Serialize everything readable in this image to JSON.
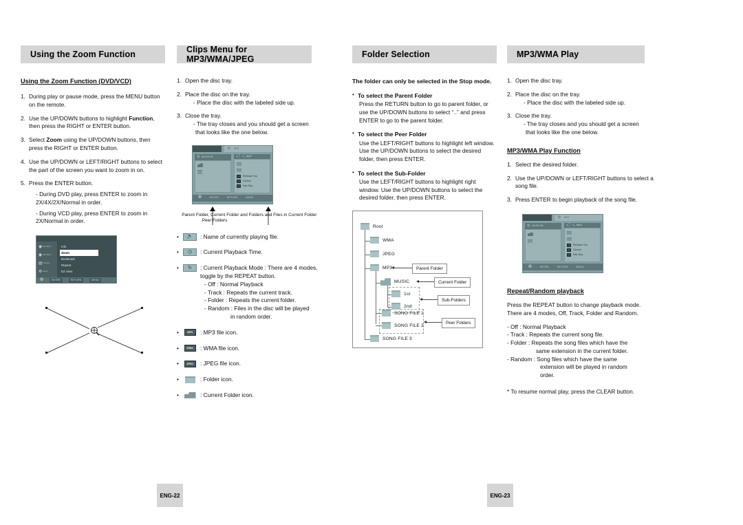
{
  "sections": [
    {
      "title": "Using the Zoom Function"
    },
    {
      "title": "Clips Menu for MP3/WMA/JPEG"
    },
    {
      "title": "Folder Selection"
    },
    {
      "title": "MP3/WMA Play"
    }
  ],
  "col1": {
    "subheading": "Using the Zoom Function (DVD/VCD)",
    "steps": [
      {
        "num": "1.",
        "text": "During play or pause mode, press the MENU button on the remote."
      },
      {
        "num": "2.",
        "text_a": "Use the UP/DOWN buttons to highlight ",
        "bold": "Function",
        "text_b": ", then press the RIGHT or ENTER button."
      },
      {
        "num": "3.",
        "text_a": "Select ",
        "bold": "Zoom",
        "text_b": " using the UP/DOWN buttons, then press the RIGHT or ENTER button."
      },
      {
        "num": "4.",
        "text": "Use the UP/DOWN or LEFT/RIGHT buttons to select the part of the screen you want to zoom in on."
      },
      {
        "num": "5.",
        "text": "Press the ENTER button.",
        "sub": [
          "- During DVD play, press ENTER to zoom in 2X/4X/2X/Normal in order.",
          "- During VCD play, press ENTER to zoom in 2X/Normal in order."
        ],
        "sub_indent": [
          "2X/4X/2X/Normal in order.",
          "in order."
        ]
      }
    ],
    "osd": {
      "side_items": [
        {
          "icon": "disc-menu-icon",
          "label": "Disc Menu"
        },
        {
          "icon": "title-menu-icon",
          "label": "Title Menu"
        },
        {
          "icon": "function-icon",
          "label": "Function"
        },
        {
          "icon": "setup-icon",
          "label": "Setup"
        }
      ],
      "menu_items": [
        "Info",
        "Zoom",
        "Bookmark",
        "Repeat",
        "EZ View"
      ],
      "selected_item": "Zoom",
      "buttons": [
        "ENTER",
        "RETURN",
        "MENU"
      ]
    },
    "zoom_graphic": {
      "icon": "magnifier-icon"
    }
  },
  "col2": {
    "steps": [
      {
        "num": "1.",
        "text": "Open the disc tray."
      },
      {
        "num": "2.",
        "text": "Place the disc on the tray.",
        "sub": [
          "- Place the disc with the labeled side up."
        ]
      },
      {
        "num": "3.",
        "text": "Close the tray.",
        "sub": [
          "- The tray closes and you should get a screen"
        ],
        "sub_cont": "that looks like the one below."
      }
    ],
    "clips_screen": {
      "mode_label": "Off",
      "mode_icon": "repeat-icon",
      "left_pane": {
        "icon": "clock-icon",
        "value": "00:00:23"
      },
      "right_pane": {
        "icon": "speaker-icon",
        "value": "1_.mp3"
      },
      "files": [
        "Release You",
        "Cactus",
        "Sad Day"
      ],
      "buttons": [
        "ENTER",
        "RETURN",
        "MENU"
      ]
    },
    "callouts": [
      "Parent Folder, Current Folder and Peer Folders",
      "Folders and Files in Current Folder"
    ],
    "legend": [
      {
        "icon": "playing-file-icon",
        "glyph": "speaker",
        "text": ": Name of currently playing file."
      },
      {
        "icon": "playback-time-icon",
        "glyph": "clock",
        "text": ": Current Playback Time."
      },
      {
        "icon": "playback-mode-icon",
        "glyph": "repeat",
        "text": ": Current Playback Mode : There are 4 modes, toggle by the REPEAT button.",
        "sub": [
          "- Off : Normal Playback",
          "- Track : Repeats the current track.",
          "- Folder : Repeats the current folder.",
          "- Random : Files in the disc will be played"
        ],
        "sub_cont": "in random order."
      },
      {
        "icon": "mp3-file-icon",
        "tag": "MP3",
        "text": ": MP3 file icon."
      },
      {
        "icon": "wma-file-icon",
        "tag": "WMA",
        "text": ": WMA file icon."
      },
      {
        "icon": "jpeg-file-icon",
        "tag": "JPEG",
        "text": ": JPEG file icon."
      },
      {
        "icon": "folder-icon",
        "shape": "folder",
        "text": ": Folder icon."
      },
      {
        "icon": "current-folder-icon",
        "shape": "current-folder",
        "text": ": Current Folder icon."
      }
    ]
  },
  "col3": {
    "intro": "The folder can only be selected in the Stop mode.",
    "blocks": [
      {
        "head": "To select the Parent Folder",
        "body": "Press the RETURN button to go to parent folder, or use the UP/DOWN buttons to select “..” and press ENTER to go to the parent folder."
      },
      {
        "head": "To select the Peer Folder",
        "body": "Use the LEFT/RIGHT buttons to highlight left window. Use the UP/DOWN buttons to select the desired folder, then press ENTER."
      },
      {
        "head": "To select the Sub-Folder",
        "body": "Use the LEFT/RIGHT buttons to highlight right window. Use the UP/DOWN buttons to select the desired folder, then press ENTER."
      }
    ],
    "tree": {
      "nodes": [
        {
          "label": "Root"
        },
        {
          "label": "WMA"
        },
        {
          "label": "JPEG"
        },
        {
          "label": "MP3"
        },
        {
          "label": "MUSIC"
        },
        {
          "label": "1st"
        },
        {
          "label": "2nd"
        },
        {
          "label": "SONG FILE 1"
        },
        {
          "label": "SONG FILE 2"
        },
        {
          "label": "SONG FILE 3"
        }
      ],
      "callouts": [
        "Parent Folder",
        "Current Folder",
        "Sub-Folders",
        "Peer Folders"
      ]
    }
  },
  "col4": {
    "steps": [
      {
        "num": "1.",
        "text": "Open the disc tray."
      },
      {
        "num": "2.",
        "text": "Place the disc on the tray.",
        "sub": [
          "- Place the disc with the labeled side up."
        ]
      },
      {
        "num": "3.",
        "text": "Close the tray.",
        "sub": [
          "- The tray closes and you should get a screen"
        ],
        "sub_cont": "that looks like the one below."
      }
    ],
    "subheading": "MP3/WMA Play Function",
    "play_steps": [
      {
        "num": "1.",
        "text": "Select the desired folder."
      },
      {
        "num": "2.",
        "text": "Use the UP/DOWN or LEFT/RIGHT buttons to select a song file."
      },
      {
        "num": "3.",
        "text": "Press ENTER to begin playback of the song file."
      }
    ],
    "play_screen": {
      "mode_label": "Off",
      "left_pane": {
        "icon": "clock-icon",
        "value": "00:00:23"
      },
      "right_pane": {
        "icon": "speaker-icon",
        "value": "1_.mp3"
      },
      "files": [
        "Release You",
        "Cactus",
        "Sad Day"
      ],
      "buttons": [
        "ENTER",
        "RETURN",
        "MENU"
      ]
    },
    "repeat_heading": "Repeat/Random playback",
    "repeat_body": "Press the REPEAT button to change playback mode. There are 4 modes, Off, Track, Folder and Random.",
    "repeat_modes": [
      "- Off : Normal Playback",
      "- Track : Repeats the current song file.",
      "- Folder : Repeats the song files which have the"
    ],
    "repeat_folder_cont": "same extension in the current folder.",
    "repeat_random": "- Random : Song files which have the same",
    "repeat_random_cont1": "extension will be played in random",
    "repeat_random_cont2": "order.",
    "note": "* To resume normal play, press the CLEAR button."
  },
  "footers": [
    {
      "label": "ENG-22"
    },
    {
      "label": "ENG-23"
    }
  ]
}
